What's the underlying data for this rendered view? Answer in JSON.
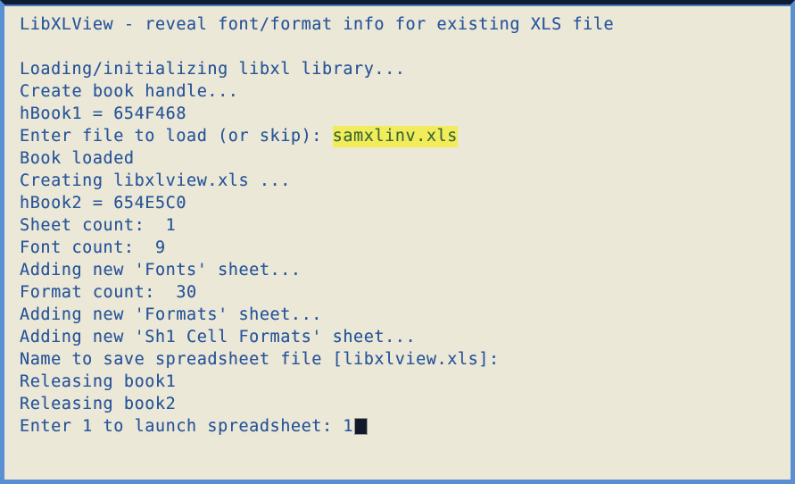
{
  "window": {
    "name": "libxlview-console-window",
    "background_color": "#EBE8D8",
    "text_color": "#2A5699",
    "border_color": "#5B8FD4",
    "top_edge_color": "#0D1B33",
    "highlight_background": "#F2EC5A",
    "highlight_text_color": "#3B6B2F",
    "caret_color": "#13182B"
  },
  "console": {
    "title_line": "LibXLView - reveal font/format info for existing XLS file",
    "blank_line": "",
    "lines": [
      {
        "id": "loading",
        "text": "Loading/initializing libxl library..."
      },
      {
        "id": "create-book-handle",
        "text": "Create book handle..."
      },
      {
        "id": "hbook1",
        "text": "hBook1 = 654F468"
      },
      {
        "id": "book-loaded",
        "text": "Book loaded"
      },
      {
        "id": "creating-output",
        "text": "Creating libxlview.xls ..."
      },
      {
        "id": "hbook2",
        "text": "hBook2 = 654E5C0"
      },
      {
        "id": "sheet-count",
        "text": "Sheet count:  1"
      },
      {
        "id": "font-count",
        "text": "Font count:  9"
      },
      {
        "id": "adding-fonts-sheet",
        "text": "Adding new 'Fonts' sheet..."
      },
      {
        "id": "format-count",
        "text": "Format count:  30"
      },
      {
        "id": "adding-formats-sheet",
        "text": "Adding new 'Formats' sheet..."
      },
      {
        "id": "adding-cellformats-sheet",
        "text": "Adding new 'Sh1 Cell Formats' sheet..."
      },
      {
        "id": "save-name-prompt",
        "text": "Name to save spreadsheet file [libxlview.xls]:"
      },
      {
        "id": "releasing-book1",
        "text": "Releasing book1"
      },
      {
        "id": "releasing-book2",
        "text": "Releasing book2"
      }
    ],
    "file_prompt": {
      "label": "Enter file to load (or skip): ",
      "value": "samxlinv.xls"
    },
    "launch_prompt": {
      "label": "Enter 1 to launch spreadsheet: ",
      "value": "1"
    }
  }
}
